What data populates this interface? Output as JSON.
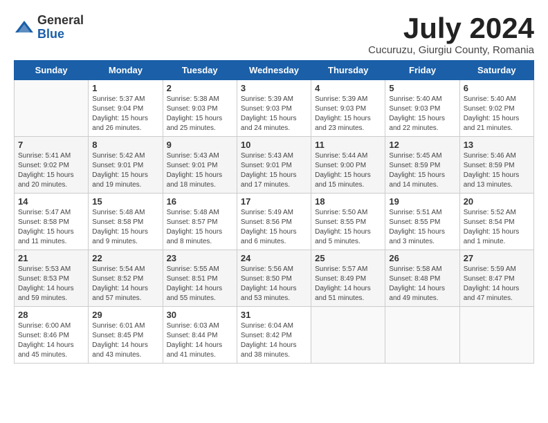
{
  "logo": {
    "general": "General",
    "blue": "Blue"
  },
  "title": "July 2024",
  "location": "Cucuruzu, Giurgiu County, Romania",
  "weekdays": [
    "Sunday",
    "Monday",
    "Tuesday",
    "Wednesday",
    "Thursday",
    "Friday",
    "Saturday"
  ],
  "weeks": [
    [
      {
        "day": "",
        "sunrise": "",
        "sunset": "",
        "daylight": ""
      },
      {
        "day": "1",
        "sunrise": "Sunrise: 5:37 AM",
        "sunset": "Sunset: 9:04 PM",
        "daylight": "Daylight: 15 hours and 26 minutes."
      },
      {
        "day": "2",
        "sunrise": "Sunrise: 5:38 AM",
        "sunset": "Sunset: 9:03 PM",
        "daylight": "Daylight: 15 hours and 25 minutes."
      },
      {
        "day": "3",
        "sunrise": "Sunrise: 5:39 AM",
        "sunset": "Sunset: 9:03 PM",
        "daylight": "Daylight: 15 hours and 24 minutes."
      },
      {
        "day": "4",
        "sunrise": "Sunrise: 5:39 AM",
        "sunset": "Sunset: 9:03 PM",
        "daylight": "Daylight: 15 hours and 23 minutes."
      },
      {
        "day": "5",
        "sunrise": "Sunrise: 5:40 AM",
        "sunset": "Sunset: 9:03 PM",
        "daylight": "Daylight: 15 hours and 22 minutes."
      },
      {
        "day": "6",
        "sunrise": "Sunrise: 5:40 AM",
        "sunset": "Sunset: 9:02 PM",
        "daylight": "Daylight: 15 hours and 21 minutes."
      }
    ],
    [
      {
        "day": "7",
        "sunrise": "Sunrise: 5:41 AM",
        "sunset": "Sunset: 9:02 PM",
        "daylight": "Daylight: 15 hours and 20 minutes."
      },
      {
        "day": "8",
        "sunrise": "Sunrise: 5:42 AM",
        "sunset": "Sunset: 9:01 PM",
        "daylight": "Daylight: 15 hours and 19 minutes."
      },
      {
        "day": "9",
        "sunrise": "Sunrise: 5:43 AM",
        "sunset": "Sunset: 9:01 PM",
        "daylight": "Daylight: 15 hours and 18 minutes."
      },
      {
        "day": "10",
        "sunrise": "Sunrise: 5:43 AM",
        "sunset": "Sunset: 9:01 PM",
        "daylight": "Daylight: 15 hours and 17 minutes."
      },
      {
        "day": "11",
        "sunrise": "Sunrise: 5:44 AM",
        "sunset": "Sunset: 9:00 PM",
        "daylight": "Daylight: 15 hours and 15 minutes."
      },
      {
        "day": "12",
        "sunrise": "Sunrise: 5:45 AM",
        "sunset": "Sunset: 8:59 PM",
        "daylight": "Daylight: 15 hours and 14 minutes."
      },
      {
        "day": "13",
        "sunrise": "Sunrise: 5:46 AM",
        "sunset": "Sunset: 8:59 PM",
        "daylight": "Daylight: 15 hours and 13 minutes."
      }
    ],
    [
      {
        "day": "14",
        "sunrise": "Sunrise: 5:47 AM",
        "sunset": "Sunset: 8:58 PM",
        "daylight": "Daylight: 15 hours and 11 minutes."
      },
      {
        "day": "15",
        "sunrise": "Sunrise: 5:48 AM",
        "sunset": "Sunset: 8:58 PM",
        "daylight": "Daylight: 15 hours and 9 minutes."
      },
      {
        "day": "16",
        "sunrise": "Sunrise: 5:48 AM",
        "sunset": "Sunset: 8:57 PM",
        "daylight": "Daylight: 15 hours and 8 minutes."
      },
      {
        "day": "17",
        "sunrise": "Sunrise: 5:49 AM",
        "sunset": "Sunset: 8:56 PM",
        "daylight": "Daylight: 15 hours and 6 minutes."
      },
      {
        "day": "18",
        "sunrise": "Sunrise: 5:50 AM",
        "sunset": "Sunset: 8:55 PM",
        "daylight": "Daylight: 15 hours and 5 minutes."
      },
      {
        "day": "19",
        "sunrise": "Sunrise: 5:51 AM",
        "sunset": "Sunset: 8:55 PM",
        "daylight": "Daylight: 15 hours and 3 minutes."
      },
      {
        "day": "20",
        "sunrise": "Sunrise: 5:52 AM",
        "sunset": "Sunset: 8:54 PM",
        "daylight": "Daylight: 15 hours and 1 minute."
      }
    ],
    [
      {
        "day": "21",
        "sunrise": "Sunrise: 5:53 AM",
        "sunset": "Sunset: 8:53 PM",
        "daylight": "Daylight: 14 hours and 59 minutes."
      },
      {
        "day": "22",
        "sunrise": "Sunrise: 5:54 AM",
        "sunset": "Sunset: 8:52 PM",
        "daylight": "Daylight: 14 hours and 57 minutes."
      },
      {
        "day": "23",
        "sunrise": "Sunrise: 5:55 AM",
        "sunset": "Sunset: 8:51 PM",
        "daylight": "Daylight: 14 hours and 55 minutes."
      },
      {
        "day": "24",
        "sunrise": "Sunrise: 5:56 AM",
        "sunset": "Sunset: 8:50 PM",
        "daylight": "Daylight: 14 hours and 53 minutes."
      },
      {
        "day": "25",
        "sunrise": "Sunrise: 5:57 AM",
        "sunset": "Sunset: 8:49 PM",
        "daylight": "Daylight: 14 hours and 51 minutes."
      },
      {
        "day": "26",
        "sunrise": "Sunrise: 5:58 AM",
        "sunset": "Sunset: 8:48 PM",
        "daylight": "Daylight: 14 hours and 49 minutes."
      },
      {
        "day": "27",
        "sunrise": "Sunrise: 5:59 AM",
        "sunset": "Sunset: 8:47 PM",
        "daylight": "Daylight: 14 hours and 47 minutes."
      }
    ],
    [
      {
        "day": "28",
        "sunrise": "Sunrise: 6:00 AM",
        "sunset": "Sunset: 8:46 PM",
        "daylight": "Daylight: 14 hours and 45 minutes."
      },
      {
        "day": "29",
        "sunrise": "Sunrise: 6:01 AM",
        "sunset": "Sunset: 8:45 PM",
        "daylight": "Daylight: 14 hours and 43 minutes."
      },
      {
        "day": "30",
        "sunrise": "Sunrise: 6:03 AM",
        "sunset": "Sunset: 8:44 PM",
        "daylight": "Daylight: 14 hours and 41 minutes."
      },
      {
        "day": "31",
        "sunrise": "Sunrise: 6:04 AM",
        "sunset": "Sunset: 8:42 PM",
        "daylight": "Daylight: 14 hours and 38 minutes."
      },
      {
        "day": "",
        "sunrise": "",
        "sunset": "",
        "daylight": ""
      },
      {
        "day": "",
        "sunrise": "",
        "sunset": "",
        "daylight": ""
      },
      {
        "day": "",
        "sunrise": "",
        "sunset": "",
        "daylight": ""
      }
    ]
  ]
}
